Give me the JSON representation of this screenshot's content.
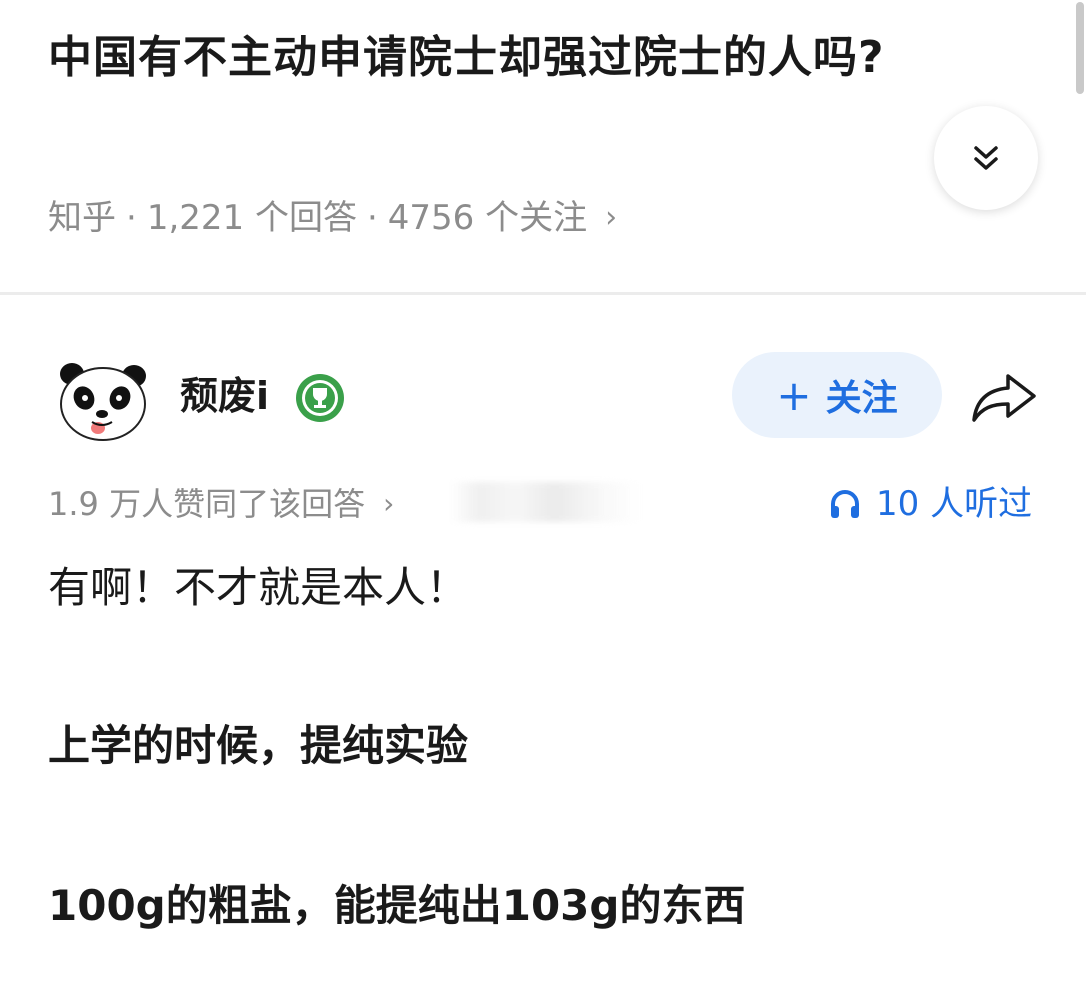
{
  "question": {
    "title": "中国有不主动申请院士却强过院士的人吗?",
    "source": "知乎",
    "answers_count": "1,221 个回答",
    "followers_count": "4756 个关注"
  },
  "author": {
    "name": "颓废i",
    "follow_label": "关注"
  },
  "answer_meta": {
    "votes_text": "1.9 万人赞同了该回答",
    "listened_text": "10 人听过"
  },
  "answer": {
    "paragraphs": [
      "有啊！不才就是本人！",
      "上学的时候，提纯实验",
      "100g的粗盐，能提纯出103g的东西"
    ]
  },
  "colors": {
    "accent": "#1f6ee0",
    "follow_bg": "#eaf2fc",
    "meta_text": "#8c8c8c",
    "badge_green": "#3aa04a"
  },
  "icons": {
    "expand": "double-chevron-down-icon",
    "badge": "trophy-badge-icon",
    "share": "share-arrow-icon",
    "listen": "headphones-icon"
  }
}
